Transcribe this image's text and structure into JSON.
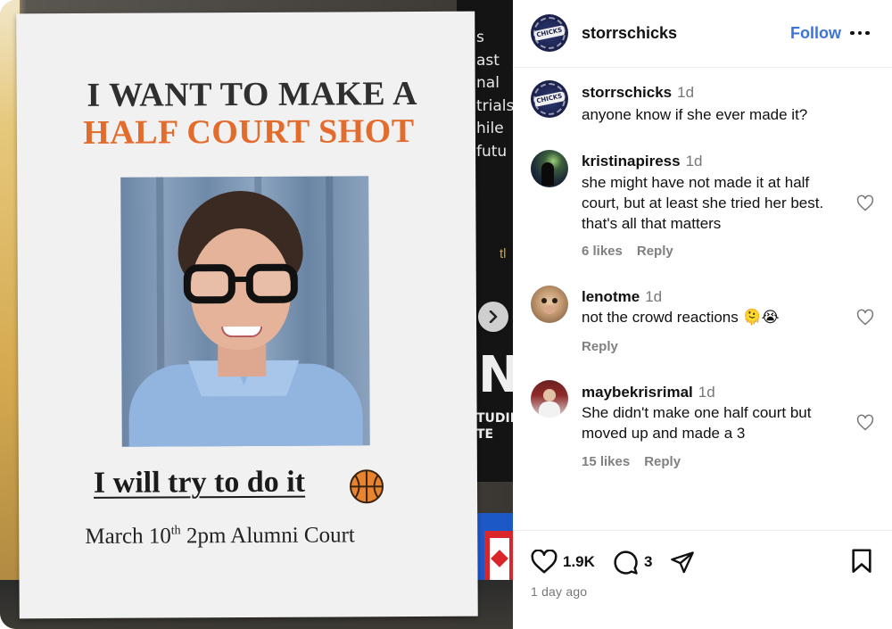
{
  "post": {
    "image_alt": "Flyer on a bulletin board",
    "flyer": {
      "headline_line1": "I WANT TO MAKE A",
      "headline_line2": "HALF COURT SHOT",
      "subline": "I will try to do it",
      "when_date": "March 10",
      "when_suffix": "th",
      "when_rest": "2pm Alumni Court"
    },
    "background_poster_text": "s\nast\nnal\ntrials\nhile\nfutu",
    "background_poster_big": "N",
    "background_poster_small": "TUDIE\nTE",
    "background_poster_th": "tl"
  },
  "header": {
    "username": "storrschicks",
    "follow_label": "Follow",
    "logo_text": "CHICKS"
  },
  "comments": [
    {
      "username": "storrschicks",
      "time": "1d",
      "text": "anyone know if she ever made it?"
    },
    {
      "username": "kristinapiress",
      "time": "1d",
      "text": "she might have not made it at half court, but at least she tried her best. that's all that matters",
      "likes": "6 likes",
      "reply": "Reply"
    },
    {
      "username": "lenotme",
      "time": "1d",
      "text": "not the crowd reactions 🫠😭",
      "reply": "Reply"
    },
    {
      "username": "maybekrisrimal",
      "time": "1d",
      "text": "She didn't make one half court but moved up and made a 3",
      "likes": "15 likes",
      "reply": "Reply"
    }
  ],
  "footer": {
    "like_count": "1.9K",
    "comment_count": "3",
    "posted": "1 day ago"
  },
  "colors": {
    "accent_follow": "#3d74d9",
    "headline_orange": "#e36b2c",
    "muted_text": "#777777"
  },
  "icons": [
    "chevron-right-icon",
    "more-icon",
    "heart-icon",
    "comment-icon",
    "share-icon",
    "bookmark-icon",
    "basketball-icon"
  ]
}
